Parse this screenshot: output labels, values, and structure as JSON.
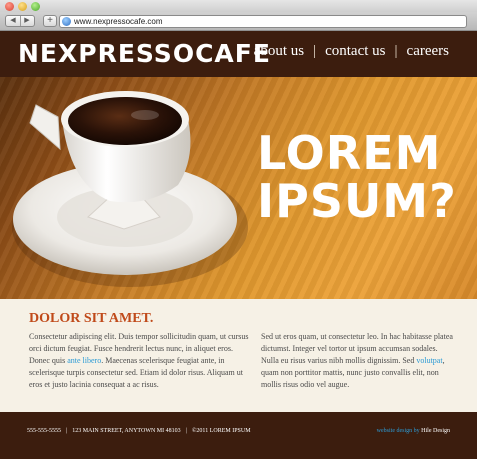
{
  "browser": {
    "url": "www.nexpressocafe.com",
    "nav_back": "◀",
    "nav_forward": "▶",
    "add_tab": "+"
  },
  "site": {
    "logo": "NEXPRESSOCAFE",
    "nav": [
      {
        "label": "about us"
      },
      {
        "label": "contact us"
      },
      {
        "label": "careers"
      }
    ],
    "nav_separator": "|",
    "hero": {
      "line1": "LOREM",
      "line2": "IPSUM?"
    },
    "section_title": "DOLOR SIT AMET.",
    "left_column": {
      "text_before": "Consectetur adipiscing elit. Duis tempor sollicitudin quam, ut cursus orci dictum feugiat. Fusce hendrerit lectus nunc, in aliquet eros. Donec quis",
      "highlight": "ante libero",
      "text_after": ". Maecenas scelerisque feugiat ante, in scelerisque turpis consectetur sed. Etiam id dolor risus. Aliquam ut eros et justo lacinia consequat a ac risus."
    },
    "right_column": {
      "text_before": "Sed ut eros quam, ut consectetur leo. In hac habitasse platea dictumst. Integer vel tortor ut ipsum accumsan sodales. Nulla eu risus varius nibh mollis dignissim. Sed",
      "highlight": "volutpat",
      "text_after": ", quam non porttitor mattis, nunc justo convallis elit, non mollis risus odio vel augue."
    },
    "footer": {
      "phone": "555-555-5555",
      "address": "123 MAIN STREET, ANYTOWN MI 48103",
      "copyright": "©2011 LOREM IPSUM",
      "separator": "|",
      "credit_label": "website design by",
      "credit_name": "Hile Design"
    }
  },
  "colors": {
    "header_bg": "#3c1d0e",
    "accent_title": "#c04a1a",
    "link_highlight": "#2c9bd5",
    "content_bg": "#f6f1e6"
  },
  "icons": [
    "globe-icon",
    "back-arrow-icon",
    "forward-arrow-icon",
    "plus-icon",
    "close-window-icon",
    "minimize-window-icon",
    "zoom-window-icon"
  ]
}
